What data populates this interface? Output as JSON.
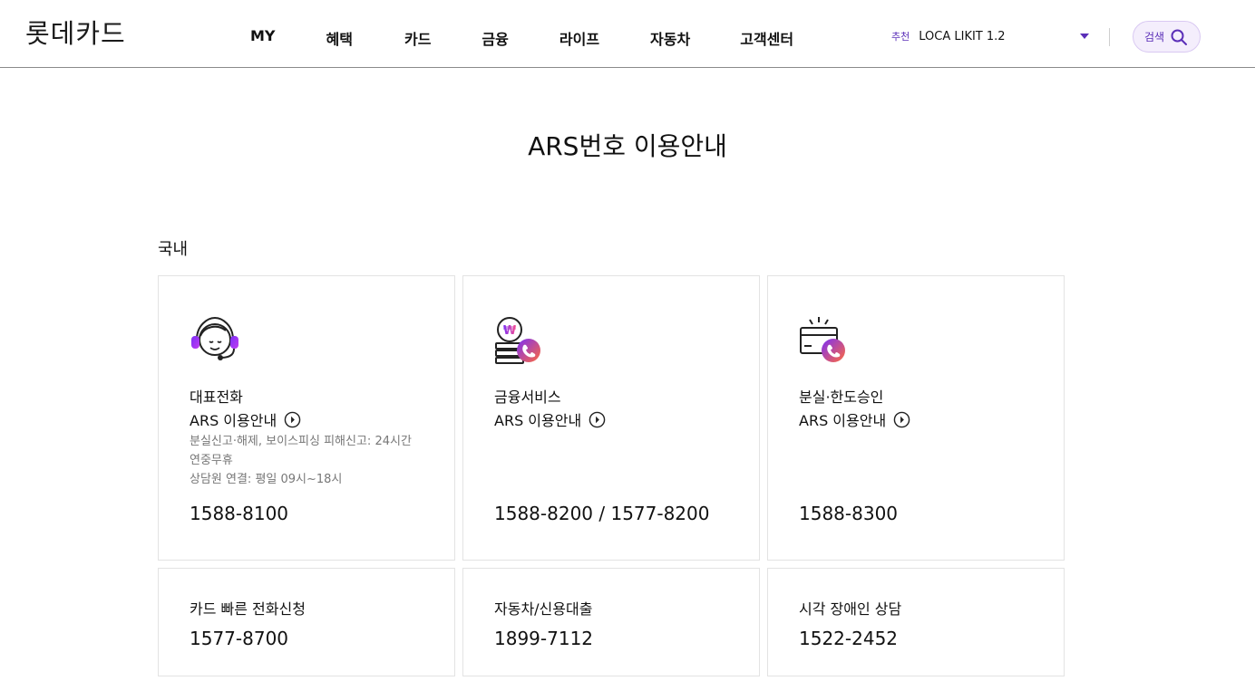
{
  "header": {
    "logo": "롯데카드",
    "nav": [
      "MY",
      "혜택",
      "카드",
      "금융",
      "라이프",
      "자동차",
      "고객센터"
    ],
    "recommend_tag": "추천",
    "recommend_text": "LOCA LIKIT 1.2",
    "search_label": "검색"
  },
  "page": {
    "title": "ARS번호 이용안내",
    "section": "국내"
  },
  "cards": [
    {
      "name": "대표전화",
      "link": "ARS 이용안내",
      "desc1": "분실신고·해제, 보이스피싱 피해신고: 24시간",
      "desc2": "연중무휴",
      "desc3": "상담원 연결: 평일 09시~18시",
      "phone": "1588-8100",
      "icon": "headset-agent-icon"
    },
    {
      "name": "금융서비스",
      "link": "ARS 이용안내",
      "phone": "1588-8200 / 1577-8200",
      "icon": "coin-phone-icon"
    },
    {
      "name": "분실·한도승인",
      "link": "ARS 이용안내",
      "phone": "1588-8300",
      "icon": "card-phone-icon"
    },
    {
      "name": "카드 빠른 전화신청",
      "phone": "1577-8700"
    },
    {
      "name": "자동차/신용대출",
      "phone": "1899-7112"
    },
    {
      "name": "시각 장애인 상담",
      "phone": "1522-2452"
    }
  ],
  "colors": {
    "accent": "#5b2fb8",
    "icon_gradient_start": "#7b2ff7",
    "icon_gradient_end": "#ff6a3d"
  }
}
